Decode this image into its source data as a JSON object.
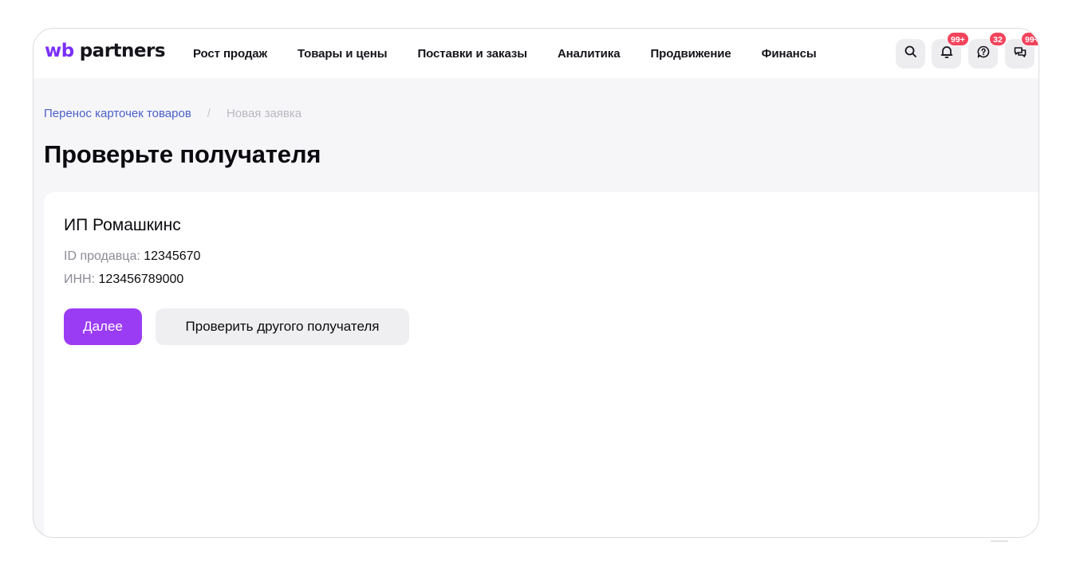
{
  "header": {
    "logo": {
      "wb": "wb",
      "partners": "partners"
    },
    "nav": [
      {
        "label": "Рост продаж"
      },
      {
        "label": "Товары и цены"
      },
      {
        "label": "Поставки и заказы"
      },
      {
        "label": "Аналитика"
      },
      {
        "label": "Продвижение"
      },
      {
        "label": "Финансы"
      }
    ],
    "icons": {
      "search": "search-icon",
      "notifications": {
        "icon": "bell-icon",
        "badge": "99+"
      },
      "questions": {
        "icon": "question-chat-icon",
        "badge": "32"
      },
      "chats": {
        "icon": "chats-icon",
        "badge": "99+"
      }
    }
  },
  "breadcrumb": {
    "link": "Перенос карточек товаров",
    "separator": "/",
    "current": "Новая заявка"
  },
  "page_title": "Проверьте получателя",
  "recipient": {
    "name": "ИП Ромашкинс",
    "seller_id_label": "ID продавца:",
    "seller_id": "12345670",
    "inn_label": "ИНН:",
    "inn": "123456789000"
  },
  "actions": {
    "next": "Далее",
    "check_other": "Проверить другого получателя"
  },
  "colors": {
    "brand": "#7b2ff7",
    "primary_button": "#9b3cf5",
    "badge": "#f2445c",
    "link": "#4a5fc6"
  }
}
